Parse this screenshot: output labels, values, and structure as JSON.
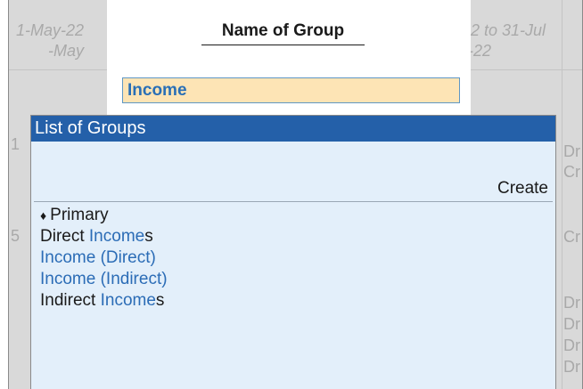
{
  "background": {
    "period_from_line1": "1-May-22",
    "period_from_line2": "-May",
    "period_to_line1": "2 to 31-Jul",
    "period_to_line2": "-22",
    "left_fragments": [
      "1",
      "5"
    ],
    "right_fragments": [
      "Dr",
      "Cr",
      "Cr",
      "Dr",
      "Dr",
      "Dr",
      "Dr"
    ]
  },
  "name_of_group": {
    "title": "Name of Group",
    "value": "Income"
  },
  "list_of_groups": {
    "header": "List of Groups",
    "create_label": "Create",
    "items": [
      {
        "bullet": "♦",
        "parts": [
          {
            "text": "Primary",
            "match": false
          }
        ]
      },
      {
        "parts": [
          {
            "text": "Direct ",
            "match": false
          },
          {
            "text": "Income",
            "match": true
          },
          {
            "text": "s",
            "match": false
          }
        ]
      },
      {
        "parts": [
          {
            "text": "Income (Direct)",
            "match": true
          }
        ]
      },
      {
        "parts": [
          {
            "text": "Income (Indirect)",
            "match": true
          }
        ]
      },
      {
        "parts": [
          {
            "text": "Indirect ",
            "match": false
          },
          {
            "text": "Income",
            "match": true
          },
          {
            "text": "s",
            "match": false
          }
        ]
      }
    ]
  },
  "colors": {
    "header_bg": "#2460a9",
    "list_bg": "#e3effa",
    "input_bg": "#fde4b5",
    "match_text": "#2b6cb6"
  }
}
